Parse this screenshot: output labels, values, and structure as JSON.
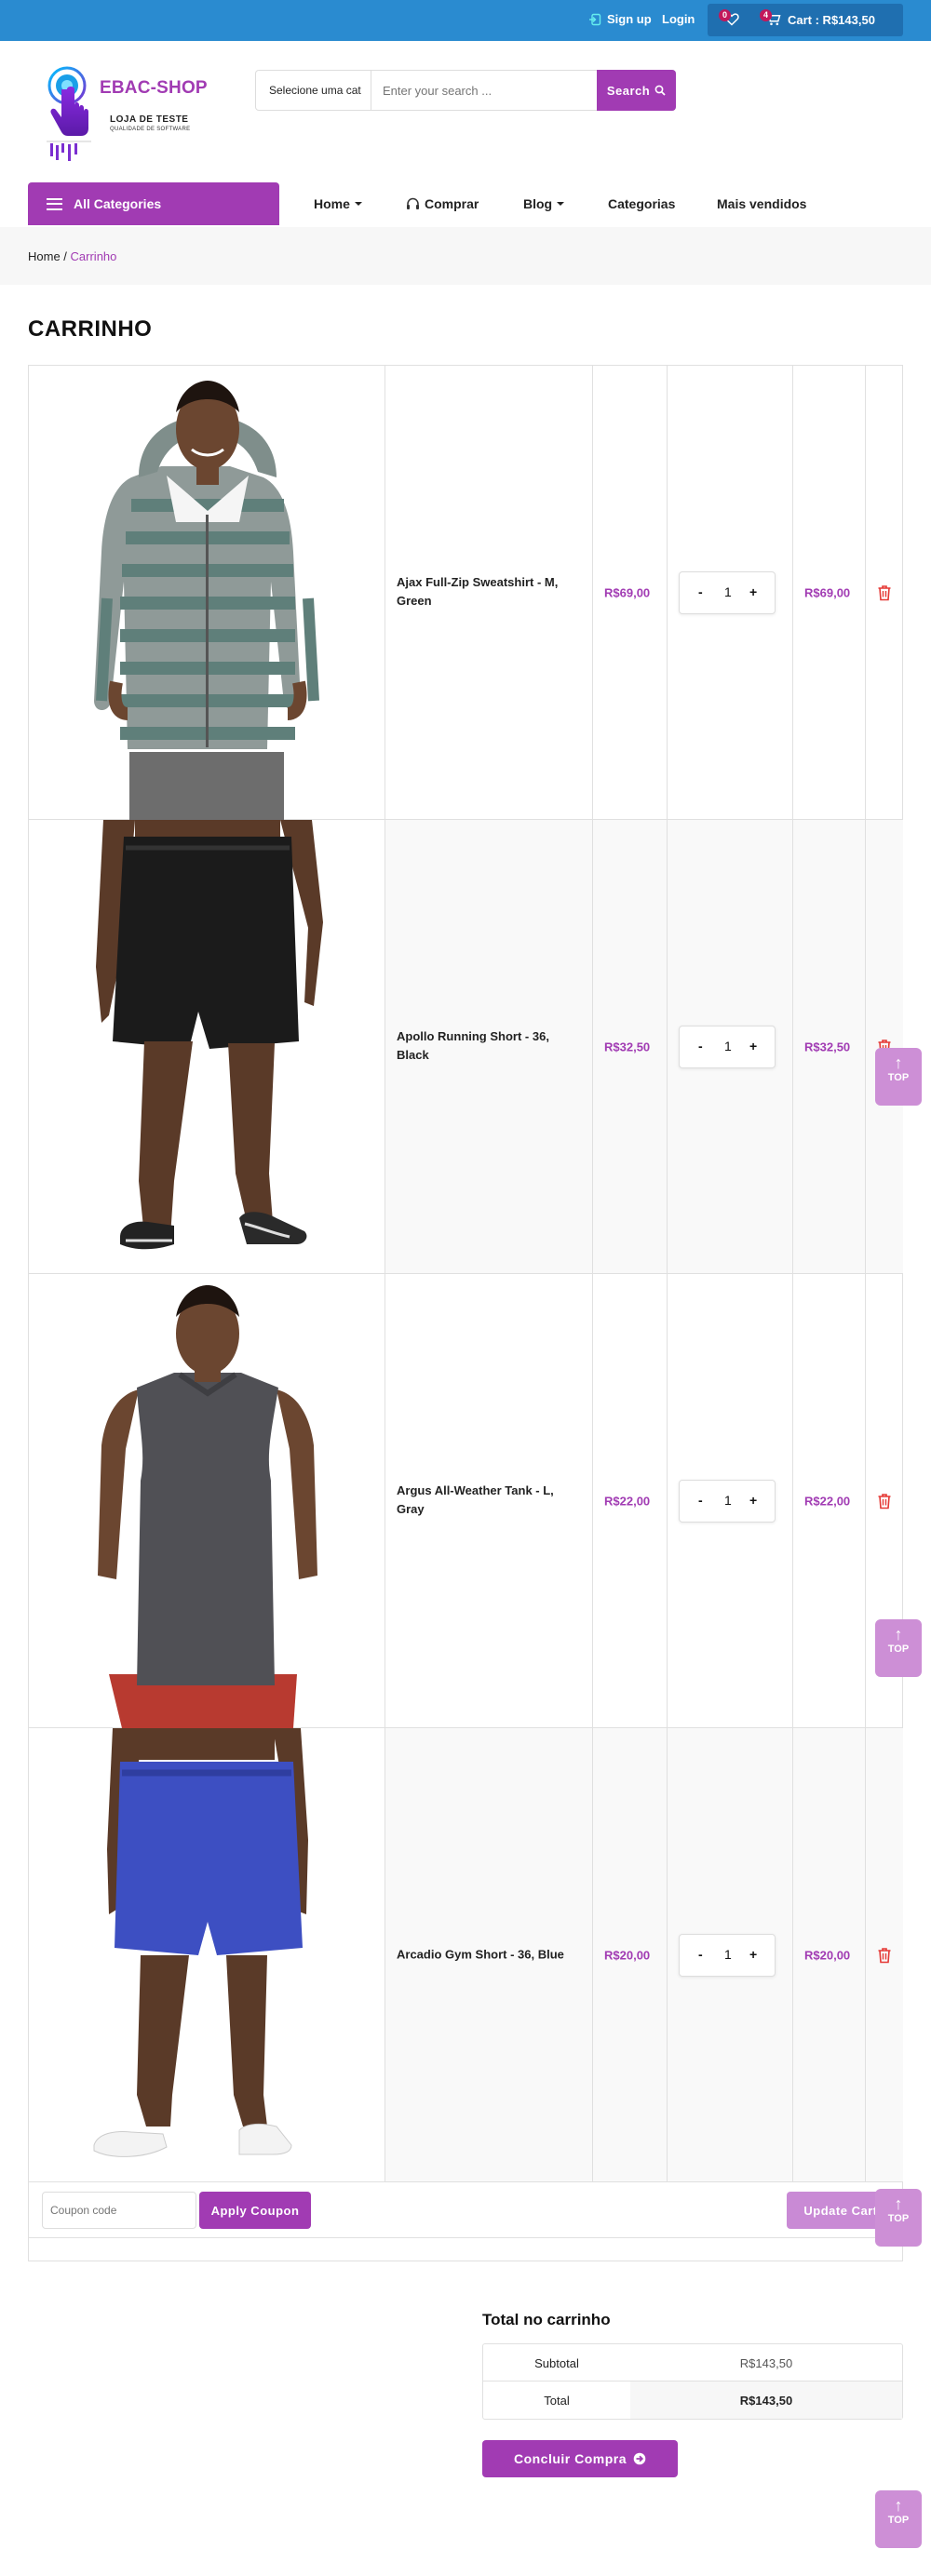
{
  "topbar": {
    "signup": "Sign up",
    "login": "Login",
    "wishlist_count": "0",
    "cart_count": "4",
    "cart_label": "Cart : R$143,50"
  },
  "header": {
    "brand": "EBAC-SHOP",
    "tagline1": "LOJA DE TESTE",
    "tagline2": "QUALIDADE DE SOFTWARE"
  },
  "search": {
    "category": "Selecione uma cat",
    "placeholder": "Enter your search ...",
    "button": "Search"
  },
  "nav": {
    "all_categories": "All Categories",
    "home": "Home",
    "comprar": "Comprar",
    "blog": "Blog",
    "categorias": "Categorias",
    "mais_vendidos": "Mais vendidos"
  },
  "breadcrumb": {
    "home": "Home",
    "separator": " / ",
    "current": "Carrinho"
  },
  "page_title": "CARRINHO",
  "cart": {
    "items": [
      {
        "name": "Ajax Full-Zip Sweatshirt - M, Green",
        "price": "R$69,00",
        "qty": "1",
        "subtotal": "R$69,00"
      },
      {
        "name": "Apollo Running Short - 36, Black",
        "price": "R$32,50",
        "qty": "1",
        "subtotal": "R$32,50"
      },
      {
        "name": "Argus All-Weather Tank - L, Gray",
        "price": "R$22,00",
        "qty": "1",
        "subtotal": "R$22,00"
      },
      {
        "name": "Arcadio Gym Short - 36, Blue",
        "price": "R$20,00",
        "qty": "1",
        "subtotal": "R$20,00"
      }
    ],
    "qty_minus": "-",
    "qty_plus": "+",
    "coupon_placeholder": "Coupon code",
    "apply_coupon": "Apply Coupon",
    "update_cart": "Update Cart"
  },
  "totals": {
    "title": "Total no carrinho",
    "subtotal_label": "Subtotal",
    "subtotal_value": "R$143,50",
    "total_label": "Total",
    "total_value": "R$143,50",
    "checkout": "Concluir Compra"
  },
  "back_to_top": "TOP",
  "colors": {
    "topbar": "#2a8bd0",
    "accent": "#a13bb3",
    "accent_light": "#cd8fd6",
    "badge": "#c2185b",
    "delete": "#e53935"
  }
}
